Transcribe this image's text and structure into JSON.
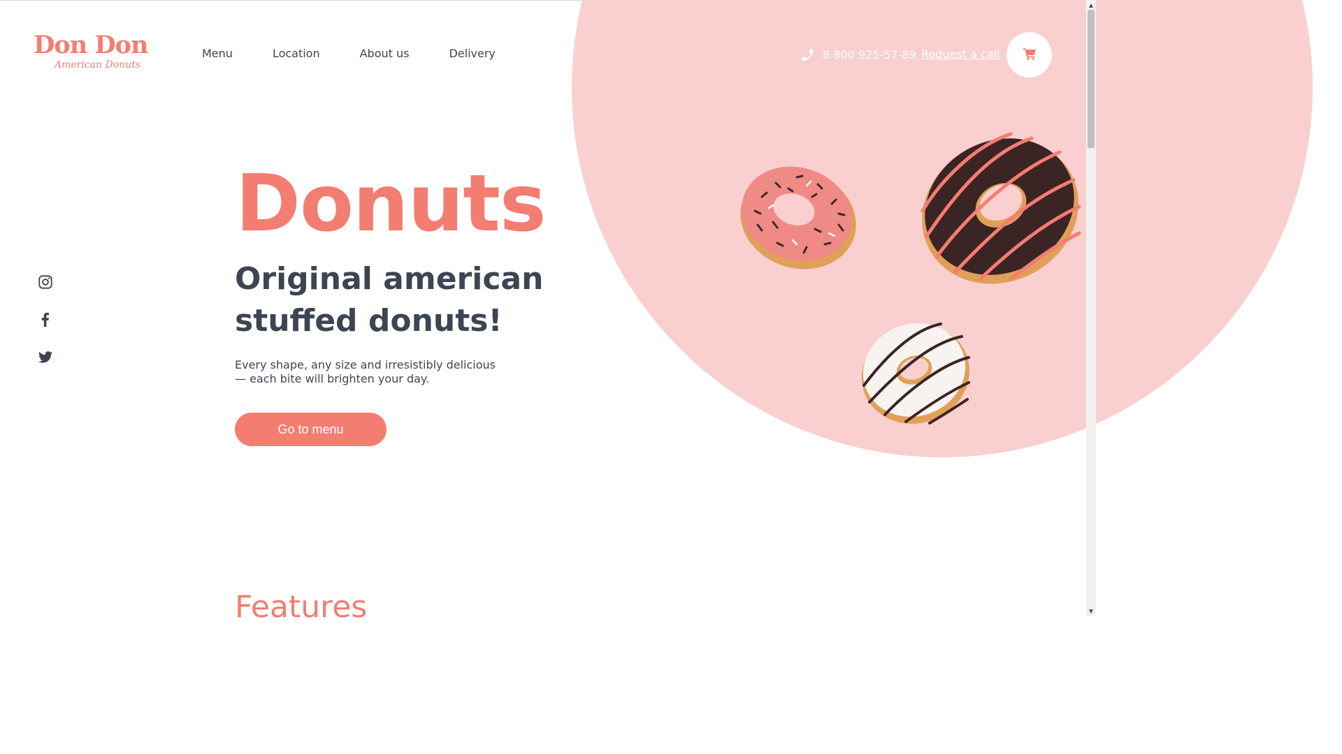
{
  "brand": {
    "name": "Don Don",
    "tagline": "American Donuts"
  },
  "nav": {
    "items": [
      {
        "label": "Menu"
      },
      {
        "label": "Location"
      },
      {
        "label": "About us"
      },
      {
        "label": "Delivery"
      }
    ]
  },
  "header": {
    "phone": "8 800 925-57-89",
    "request_call": "Request a call",
    "phone_icon": "phone-icon",
    "cart_icon": "cart-icon"
  },
  "social": {
    "items": [
      "instagram-icon",
      "facebook-icon",
      "twitter-icon"
    ]
  },
  "hero": {
    "title": "Donuts",
    "subtitle": "Original american stuffed donuts!",
    "description": "Every shape, any size and irresistibly delicious — each bite will brighten your day.",
    "cta_label": "Go to menu"
  },
  "features": {
    "heading": "Features"
  },
  "colors": {
    "accent": "#f47d72",
    "hero_bg": "#f9d0cf",
    "text": "#3d4452"
  }
}
